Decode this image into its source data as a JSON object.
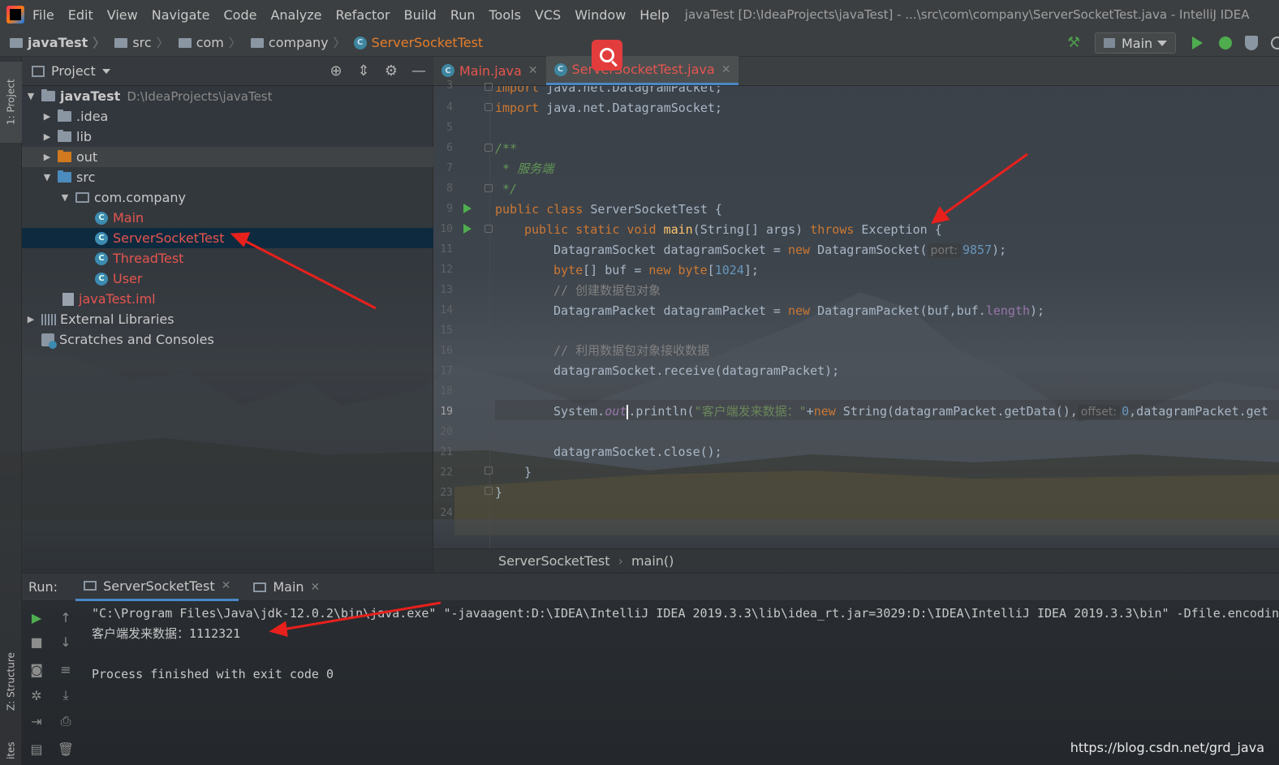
{
  "window": {
    "title": "javaTest [D:\\IdeaProjects\\javaTest] - ...\\src\\com\\company\\ServerSocketTest.java - IntelliJ IDEA"
  },
  "menu": [
    {
      "label": "File"
    },
    {
      "label": "Edit"
    },
    {
      "label": "View"
    },
    {
      "label": "Navigate"
    },
    {
      "label": "Code"
    },
    {
      "label": "Analyze"
    },
    {
      "label": "Refactor"
    },
    {
      "label": "Build"
    },
    {
      "label": "Run"
    },
    {
      "label": "Tools"
    },
    {
      "label": "VCS"
    },
    {
      "label": "Window"
    },
    {
      "label": "Help"
    }
  ],
  "breadcrumb": [
    "javaTest",
    "src",
    "com",
    "company",
    "ServerSocketTest"
  ],
  "toolbar": {
    "run_config": "Main"
  },
  "side_tabs": {
    "project": "1: Project",
    "structure": "Z: Structure",
    "favorites": "ites"
  },
  "project_panel": {
    "title": "Project",
    "tree": [
      {
        "label": "javaTest",
        "hint": "D:\\IdeaProjects\\javaTest"
      },
      {
        "label": ".idea"
      },
      {
        "label": "lib"
      },
      {
        "label": "out"
      },
      {
        "label": "src"
      },
      {
        "label": "com.company"
      },
      {
        "label": "Main"
      },
      {
        "label": "ServerSocketTest"
      },
      {
        "label": "ThreadTest"
      },
      {
        "label": "User"
      },
      {
        "label": "javaTest.iml"
      },
      {
        "label": "External Libraries"
      },
      {
        "label": "Scratches and Consoles"
      }
    ]
  },
  "editor": {
    "tabs": [
      {
        "label": "Main.java",
        "active": false
      },
      {
        "label": "ServerSocketTest.java",
        "active": true
      }
    ],
    "line_numbers": [
      "3",
      "4",
      "5",
      "6",
      "7",
      "8",
      "9",
      "10",
      "11",
      "12",
      "13",
      "14",
      "15",
      "16",
      "17",
      "18",
      "19",
      "20",
      "21",
      "22",
      "23",
      "24"
    ],
    "current_line": "19",
    "code": {
      "l3_kw": "import",
      "l3_rest": " java.net.DatagramPacket;",
      "l4_kw": "import",
      "l4_rest": " java.net.DatagramSocket;",
      "l6": "/**",
      "l7": " * 服务端",
      "l8": " */",
      "l9_kw": "public class",
      "l9_rest": " ServerSocketTest {",
      "l10_kw1": "public static void",
      "l10_fn": "main",
      "l10_mid": "(String[] args) ",
      "l10_kw2": "throws",
      "l10_rest": " Exception {",
      "l11_a": "DatagramSocket datagramSocket = ",
      "l11_new": "new",
      "l11_b": " DatagramSocket(",
      "l11_hint": "port:",
      "l11_num": "9857",
      "l11_c": ");",
      "l12_kw": "byte",
      "l12_a": "[] buf = ",
      "l12_new": "new",
      "l12_kw2": " byte",
      "l12_b": "[",
      "l12_num": "1024",
      "l12_c": "];",
      "l13": "// 创建数据包对象",
      "l14_a": "DatagramPacket datagramPacket = ",
      "l14_new": "new",
      "l14_b": " DatagramPacket(buf,buf.",
      "l14_fld": "length",
      "l14_c": ");",
      "l16": "// 利用数据包对象接收数据",
      "l17": "datagramSocket.receive(datagramPacket);",
      "l19_a": "System.",
      "l19_fld": "out",
      "l19_b": ".println(",
      "l19_str": "\"客户端发来数据：\"",
      "l19_c": "+",
      "l19_new": "new",
      "l19_d": " String(datagramPacket.getData(),",
      "l19_hint": "offset:",
      "l19_num": "0",
      "l19_e": ",datagramPacket.get",
      "l21": "datagramSocket.close();",
      "l22": "}",
      "l23": "}"
    },
    "crumbs": [
      "ServerSocketTest",
      "main()"
    ]
  },
  "run_panel": {
    "label": "Run:",
    "tabs": [
      {
        "label": "ServerSocketTest",
        "active": true
      },
      {
        "label": "Main",
        "active": false
      }
    ],
    "console": [
      "\"C:\\Program Files\\Java\\jdk-12.0.2\\bin\\java.exe\" \"-javaagent:D:\\IDEA\\IntelliJ IDEA 2019.3.3\\lib\\idea_rt.jar=3029:D:\\IDEA\\IntelliJ IDEA 2019.3.3\\bin\" -Dfile.encoding",
      "客户端发来数据：1112321",
      "",
      "Process finished with exit code 0"
    ]
  },
  "watermark": "https://blog.csdn.net/grd_java",
  "colors": {
    "accent": "#4a88c7",
    "annotation_arrow": "#e8201c",
    "keyword": "#cc7832",
    "comment": "#808080",
    "number": "#6897bb",
    "string": "#6a8759"
  }
}
